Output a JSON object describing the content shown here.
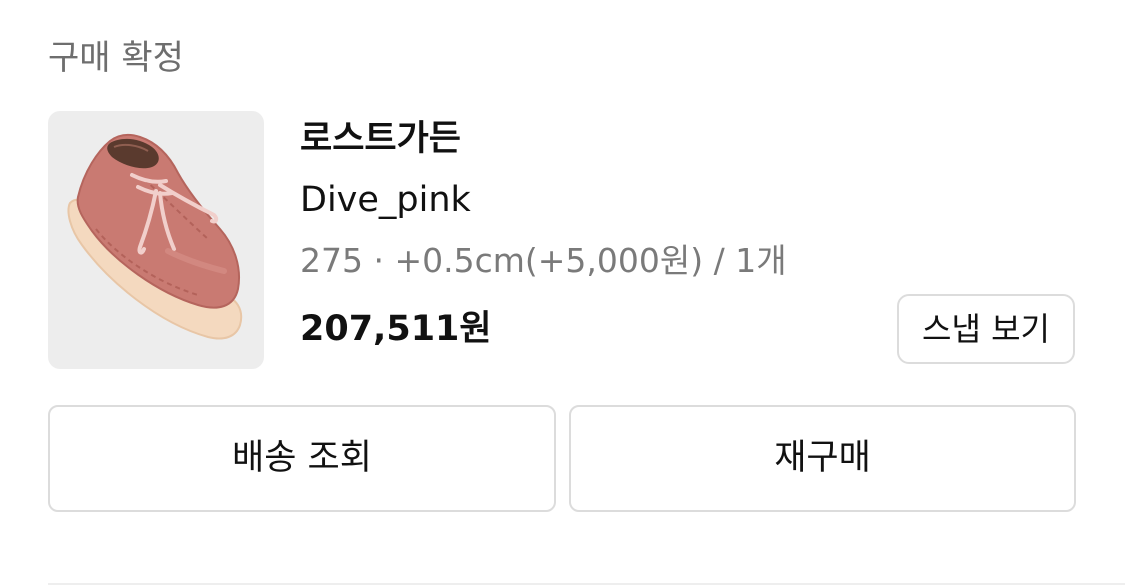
{
  "order": {
    "status_title": "구매 확정"
  },
  "product": {
    "brand": "로스트가든",
    "name": "Dive_pink",
    "option": "275 · +0.5cm(+5,000원) / 1개",
    "price": "207,511원",
    "image_icon": "pink-suede-shoe-image"
  },
  "buttons": {
    "snap_label": "스냅 보기",
    "track_label": "배송 조회",
    "rebuy_label": "재구매"
  },
  "colors": {
    "thumb_background": "#ededed",
    "border": "#dcdcdc",
    "muted_text": "#7a7a7a"
  }
}
